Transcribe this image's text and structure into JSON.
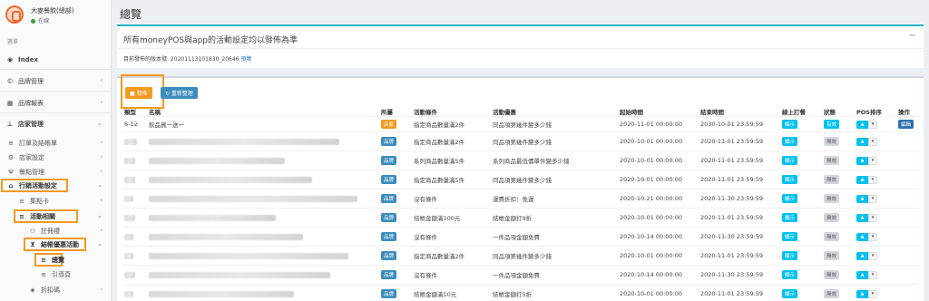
{
  "sidebar": {
    "brand_name": "大麥餐飲(總部)",
    "brand_status": "在線",
    "menu_header": "選單",
    "items": [
      {
        "label": "Index",
        "icon": "dashboard-icon",
        "glyph": "◉"
      },
      {
        "label": "品牌管理",
        "icon": "copyright-icon",
        "glyph": "©"
      },
      {
        "label": "品牌報表",
        "icon": "table-icon",
        "glyph": "▦"
      },
      {
        "label": "店家管理",
        "icon": "sitemap-icon",
        "glyph": "⊥"
      },
      {
        "label": "訂單及結帳單",
        "icon": "list-icon",
        "glyph": "≡"
      },
      {
        "label": "店家設定",
        "icon": "gears-icon",
        "glyph": "⚙"
      },
      {
        "label": "餐點管理",
        "icon": "cutlery-icon",
        "glyph": "Ψ"
      },
      {
        "label": "行銷活動設定",
        "icon": "gift-icon",
        "glyph": "⌂"
      },
      {
        "label": "集點卡",
        "icon": "list-icon",
        "glyph": "≡"
      },
      {
        "label": "活動相關",
        "icon": "list-icon",
        "glyph": "≡"
      },
      {
        "label": "註冊禮",
        "icon": "user-plus-icon",
        "glyph": "⚇"
      },
      {
        "label": "結帳優惠活動",
        "icon": "cart-icon",
        "glyph": "⊻"
      },
      {
        "label": "總覽",
        "icon": "list-icon",
        "glyph": "≡"
      },
      {
        "label": "引導頁",
        "icon": "list-icon",
        "glyph": "≡"
      },
      {
        "label": "折扣碼",
        "icon": "tag-icon",
        "glyph": "◈"
      }
    ]
  },
  "main": {
    "page_title": "總覽",
    "notice": {
      "title": "所有moneyPOS與app的活動設定均以發佈為準",
      "collapse": "−",
      "version_text": "目前發佈的版本號: 20201113101830_20646",
      "preview_link": "預覽"
    },
    "buttons": {
      "publish": "■ 發佈",
      "refresh": "↻ 重新整理"
    },
    "table": {
      "headers": [
        "類型",
        "名稱",
        "所屬",
        "活動條件",
        "活動優惠",
        "起始時間",
        "結束時間",
        "線上訂餐",
        "狀態",
        "POS排序",
        "操作"
      ],
      "rows": [
        {
          "type": "6-12",
          "name": "飲品買一送一",
          "owner": "店家",
          "owner_color": "orange",
          "condition": "指定商品數量滿2件",
          "benefit": "同品項第幾件變多少錢",
          "start": "2020-11-01 00:00:00",
          "end": "2030-10-01 23:59:59",
          "online": "顯示",
          "status": "有效",
          "status_active": true,
          "action": "編輯"
        },
        {
          "type": "",
          "name": "",
          "owner": "品牌",
          "owner_color": "blue",
          "condition": "指定商品數量滿2件",
          "benefit": "同品項第幾件變多少錢",
          "start": "2020-10-01 00:00:00",
          "end": "2020-11-01 23:59:59",
          "online": "顯示",
          "status": "無效",
          "status_active": false,
          "action": ""
        },
        {
          "type": "",
          "name": "",
          "owner": "品牌",
          "owner_color": "blue",
          "condition": "系列商品數量滿5件",
          "benefit": "系列商品最低價單件變多少錢",
          "start": "2020-10-01 00:00:00",
          "end": "2020-11-01 23:59:59",
          "online": "顯示",
          "status": "無效",
          "status_active": false,
          "action": ""
        },
        {
          "type": "",
          "name": "",
          "owner": "品牌",
          "owner_color": "blue",
          "condition": "指定商品數量滿5件",
          "benefit": "同品項第幾件變多少錢",
          "start": "2020-10-01 00:00:00",
          "end": "2020-11-01 23:59:59",
          "online": "顯示",
          "status": "無效",
          "status_active": false,
          "action": ""
        },
        {
          "type": "",
          "name": "",
          "owner": "品牌",
          "owner_color": "blue",
          "condition": "沒有條件",
          "benefit": "運費折扣：免運",
          "start": "2020-10-21 00:00:00",
          "end": "2020-11-30 23:59:59",
          "online": "顯示",
          "status": "無效",
          "status_active": false,
          "action": ""
        },
        {
          "type": "",
          "name": "",
          "owner": "品牌",
          "owner_color": "blue",
          "condition": "結帳金額滿100元",
          "benefit": "結帳金額打9折",
          "start": "2020-10-01 00:00:00",
          "end": "2020-11-01 23:59:59",
          "online": "顯示",
          "status": "無效",
          "status_active": false,
          "action": ""
        },
        {
          "type": "",
          "name": "",
          "owner": "品牌",
          "owner_color": "blue",
          "condition": "沒有條件",
          "benefit": "一件品項金額免費",
          "start": "2020-10-14 00:00:00",
          "end": "2020-11-30 23:59:59",
          "online": "顯示",
          "status": "無效",
          "status_active": false,
          "action": ""
        },
        {
          "type": "",
          "name": "",
          "owner": "品牌",
          "owner_color": "blue",
          "condition": "指定商品數量滿2件",
          "benefit": "同品項第幾件變多少錢",
          "start": "2020-10-01 00:00:00",
          "end": "2020-11-01 23:59:59",
          "online": "顯示",
          "status": "無效",
          "status_active": false,
          "action": ""
        },
        {
          "type": "",
          "name": "",
          "owner": "品牌",
          "owner_color": "blue",
          "condition": "沒有條件",
          "benefit": "一件品項金額免費",
          "start": "2020-10-14 00:00:00",
          "end": "2020-11-30 23:59:59",
          "online": "顯示",
          "status": "無效",
          "status_active": false,
          "action": ""
        },
        {
          "type": "",
          "name": "",
          "owner": "品牌",
          "owner_color": "blue",
          "condition": "結帳金額滿10元",
          "benefit": "結帳金額打5折",
          "start": "2020-10-01 00:00:00",
          "end": "2020-11-01 23:59:59",
          "online": "顯示",
          "status": "無效",
          "status_active": false,
          "action": ""
        }
      ]
    }
  },
  "colors": {
    "accent_teal": "#1fb7c4",
    "highlight_orange": "#f29a1f",
    "btn_blue": "#3c8dbc",
    "badge_cyan": "#00c0ef"
  }
}
